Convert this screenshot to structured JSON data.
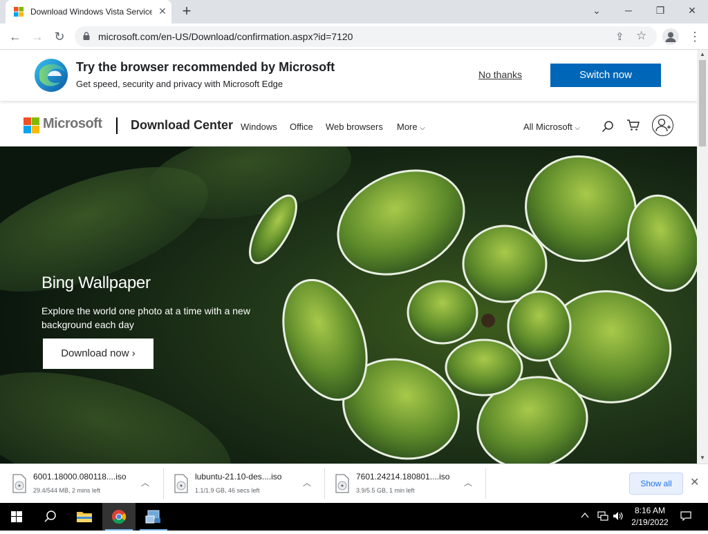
{
  "browser": {
    "tab_title": "Download Windows Vista Service",
    "url": "microsoft.com/en-US/Download/confirmation.aspx?id=7120"
  },
  "edge_banner": {
    "title": "Try the browser recommended by Microsoft",
    "subtitle": "Get speed, security and privacy with Microsoft Edge",
    "dismiss_label": "No thanks",
    "action_label": "Switch now"
  },
  "header": {
    "brand": "Microsoft",
    "site_title": "Download Center",
    "nav": [
      "Windows",
      "Office",
      "Web browsers",
      "More"
    ],
    "all_microsoft": "All Microsoft"
  },
  "hero": {
    "title": "Bing Wallpaper",
    "description": "Explore the world one photo at a time with a new background each day",
    "button_label": "Download now"
  },
  "downloads": [
    {
      "name": "6001.18000.080118....iso",
      "status": "29.4/544 MB, 2 mins left"
    },
    {
      "name": "lubuntu-21.10-des....iso",
      "status": "1.1/1.9 GB, 46 secs left"
    },
    {
      "name": "7601.24214.180801....iso",
      "status": "3.9/5.5 GB, 1 min left"
    }
  ],
  "shelf": {
    "show_all_label": "Show all"
  },
  "taskbar": {
    "time": "8:16 AM",
    "date": "2/19/2022"
  },
  "colors": {
    "accent": "#0067b8",
    "ms_red": "#f25022",
    "ms_green": "#7fba00",
    "ms_blue": "#00a4ef",
    "ms_yellow": "#ffb900"
  },
  "icons": [
    "windows-logo-icon",
    "close-icon",
    "plus-icon",
    "back-icon",
    "forward-icon",
    "reload-icon",
    "lock-icon",
    "share-icon",
    "star-icon",
    "profile-icon",
    "more-vert-icon",
    "edge-logo-icon",
    "search-icon",
    "cart-icon",
    "account-icon",
    "file-iso-icon",
    "chevron-up-icon",
    "start-icon",
    "file-explorer-icon",
    "chrome-icon",
    "network-icon",
    "volume-icon",
    "notification-icon"
  ]
}
